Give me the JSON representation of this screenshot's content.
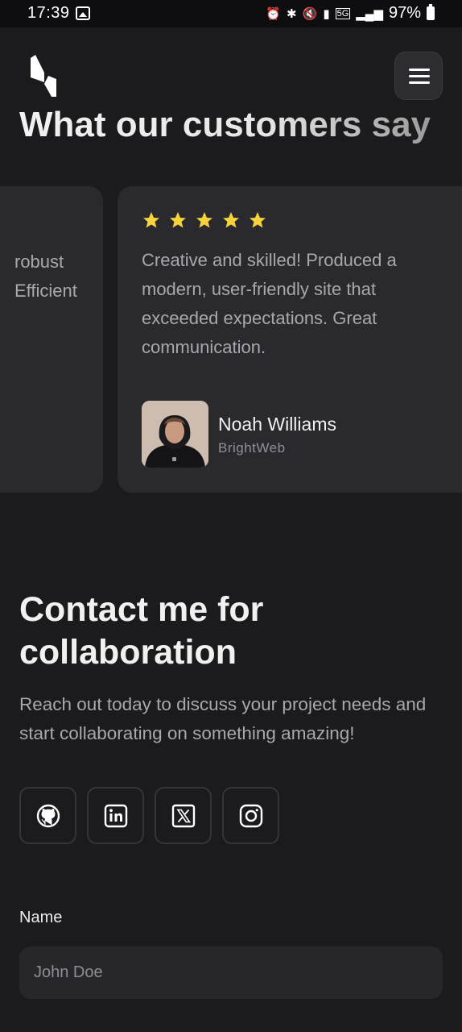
{
  "status_bar": {
    "time": "17:39",
    "battery": "97%",
    "icons": [
      "gallery-icon",
      "alarm-icon",
      "bluetooth-icon",
      "mute-icon",
      "signal-icon",
      "5g-icon",
      "signal-bars-icon",
      "battery-icon"
    ]
  },
  "header": {
    "logo": "logo-icon",
    "menu": "hamburger-menu-icon"
  },
  "testimonials": {
    "title": "What our customers say",
    "previous_card_text": "robust Efficient",
    "previous_card_lines": [
      "robust",
      "Efficient"
    ],
    "cards": [
      {
        "rating": 5,
        "text": "Creative and skilled! Produced a modern, user-friendly site that exceeded expectations. Great communication.",
        "author_name": "Noah Williams",
        "author_company": "BrightWeb"
      }
    ],
    "star_color": "#f7d33b"
  },
  "contact": {
    "title": "Contact me for collaboration",
    "description": "Reach out today to discuss your project needs and start collaborating on something amazing!",
    "social": [
      "github-icon",
      "linkedin-icon",
      "x-icon",
      "instagram-icon"
    ],
    "form": {
      "name_label": "Name",
      "name_placeholder": "John Doe"
    }
  },
  "colors": {
    "background": "#1b1b1e",
    "card": "#2a2a2e",
    "text_muted": "#a8a8ad"
  }
}
